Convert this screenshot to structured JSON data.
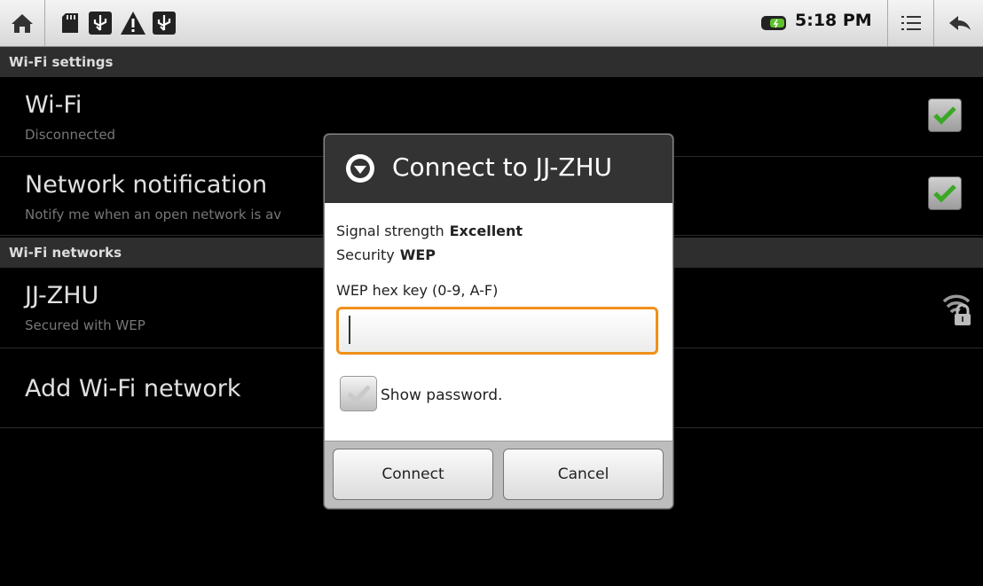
{
  "status_bar": {
    "time": "5:18 PM",
    "icons": [
      "home-icon",
      "sd-card-icon",
      "usb-icon",
      "warning-icon",
      "usb-icon",
      "battery-icon",
      "menu-icon",
      "back-icon"
    ]
  },
  "sections": {
    "wifi_settings": "Wi-Fi settings",
    "wifi_networks": "Wi-Fi networks"
  },
  "settings": {
    "wifi": {
      "title": "Wi-Fi",
      "subtitle": "Disconnected",
      "checked": true
    },
    "network_notification": {
      "title": "Network notification",
      "subtitle": "Notify me when an open network is av",
      "checked": true
    }
  },
  "networks": {
    "jj_zhu": {
      "title": "JJ-ZHU",
      "subtitle": "Secured with WEP",
      "icon": "wifi-lock-icon"
    },
    "add": {
      "title": "Add Wi-Fi network"
    }
  },
  "dialog": {
    "title": "Connect to JJ-ZHU",
    "signal_label": "Signal strength",
    "signal_value": "Excellent",
    "security_label": "Security",
    "security_value": "WEP",
    "key_label": "WEP hex key (0-9, A-F)",
    "key_value": "",
    "show_password_label": "Show password.",
    "show_password_checked": false,
    "connect_label": "Connect",
    "cancel_label": "Cancel"
  },
  "colors": {
    "accent_focus": "#f0901a",
    "check_green": "#3aa825"
  }
}
